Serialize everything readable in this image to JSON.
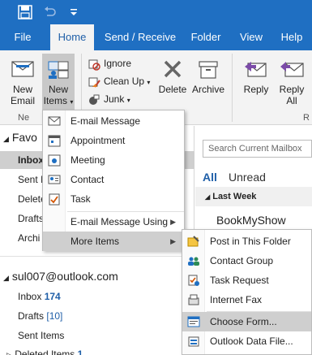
{
  "tabs": [
    "File",
    "Home",
    "Send / Receive",
    "Folder",
    "View",
    "Help"
  ],
  "ribbon": {
    "new_email": [
      "New",
      "Email"
    ],
    "new_items": [
      "New",
      "Items"
    ],
    "ignore": "Ignore",
    "clean_up": "Clean Up",
    "junk": "Junk",
    "delete": "Delete",
    "archive": "Archive",
    "reply": "Reply",
    "reply_all": [
      "Reply",
      "All"
    ],
    "group_new_partial": "Ne",
    "group_respond_partial": "R"
  },
  "nav": {
    "favorites_partial": "Favo",
    "inbox_partial": "Inbox",
    "sent_partial": "Sent I",
    "deleted_partial": "Delete",
    "drafts_partial": "Drafts",
    "archive_partial": "Archi",
    "account": "sul007@outlook.com",
    "inbox": "Inbox",
    "inbox_count": "174",
    "drafts": "Drafts",
    "drafts_count": "[10]",
    "sent_items": "Sent Items",
    "deleted_items": "Deleted Items",
    "deleted_count": "1"
  },
  "list": {
    "search_placeholder": "Search Current Mailbox",
    "all": "All",
    "unread": "Unread",
    "group": "Last Week",
    "sender": "BookMyShow"
  },
  "menu1": {
    "items": [
      "E-mail Message",
      "Appointment",
      "Meeting",
      "Contact",
      "Task",
      "E-mail Message Using",
      "More Items"
    ]
  },
  "menu2": {
    "items": [
      "Post in This Folder",
      "Contact Group",
      "Task Request",
      "Internet Fax",
      "Choose Form...",
      "Outlook Data File..."
    ]
  },
  "colors": {
    "brand_blue": "#1f6fc2",
    "highlight": "#cfcfcf"
  }
}
